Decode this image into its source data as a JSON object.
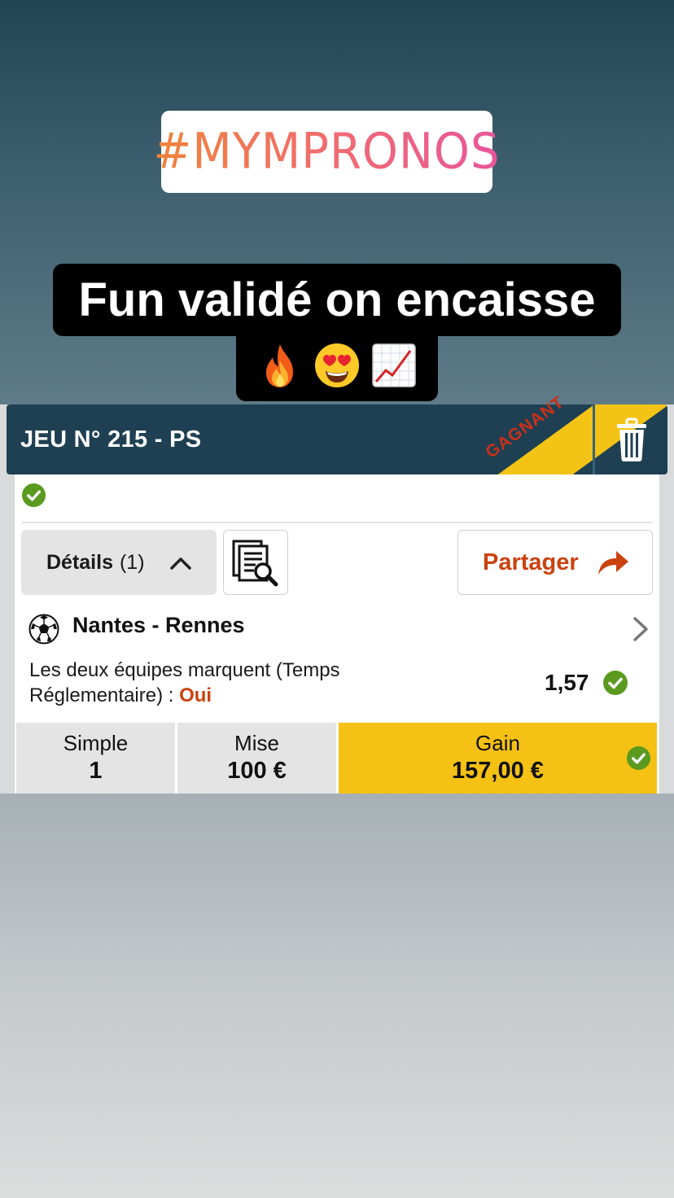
{
  "story": {
    "hashtag": "#MYMPRONOS",
    "caption": "Fun validé on encaisse",
    "emojis": [
      "fire-emoji",
      "heart-eyes-emoji",
      "chart-increasing-emoji"
    ]
  },
  "bet": {
    "title": "JEU N° 215 - PS",
    "status_ribbon": "GAGNANT",
    "status_icon": "check-circle-icon",
    "details_label": "Détails",
    "details_count": "(1)",
    "share_label": "Partager",
    "selection": {
      "sport_icon": "soccer-ball-icon",
      "match": "Nantes - Rennes",
      "market": "Les deux équipes marquent (Temps Réglementaire) : ",
      "choice": "Oui",
      "odds": "1,57"
    },
    "summary": {
      "type_label": "Simple",
      "type_value": "1",
      "stake_label": "Mise",
      "stake_value": "100 €",
      "gain_label": "Gain",
      "gain_value": "157,00 €"
    }
  },
  "colors": {
    "header_bg": "#1e4052",
    "ribbon": "#f3c316",
    "ribbon_text": "#c9301a",
    "accent_orange": "#c9420f",
    "success_green": "#5a9a1e",
    "gain_bg": "#f5c114"
  }
}
